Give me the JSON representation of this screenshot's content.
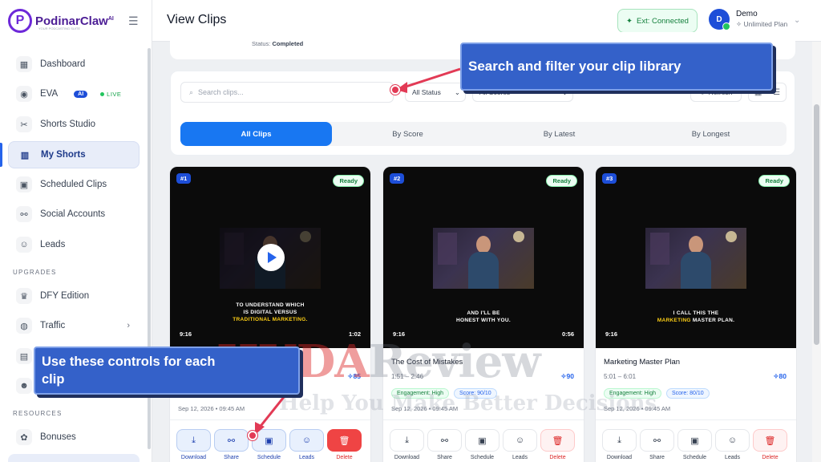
{
  "app": {
    "logo_letter": "P",
    "logo_name": "PodinarClaw",
    "logo_ai": "AI",
    "logo_tagline": "YOUR PODCASTING SUITE"
  },
  "sidebar": {
    "items": [
      {
        "label": "Dashboard",
        "icon": "▦"
      },
      {
        "label": "EVA",
        "icon": "◉",
        "badge": "AI",
        "live": "LIVE"
      },
      {
        "label": "Shorts Studio",
        "icon": "✂"
      },
      {
        "label": "My Shorts",
        "icon": "▥"
      },
      {
        "label": "Scheduled Clips",
        "icon": "▣"
      },
      {
        "label": "Social Accounts",
        "icon": "⚯"
      },
      {
        "label": "Leads",
        "icon": "☺"
      }
    ],
    "upgrades_label": "UPGRADES",
    "upgrade_items": [
      {
        "label": "DFY Edition",
        "icon": "♛"
      },
      {
        "label": "Traffic",
        "icon": "◍"
      }
    ],
    "resources_label": "RESOURCES",
    "resource_items": [
      {
        "label": "Bonuses",
        "icon": "✿"
      }
    ]
  },
  "header": {
    "title": "View Clips",
    "ext_status": "Ext: Connected",
    "user_initial": "D",
    "user_name": "Demo",
    "user_plan": "Unlimited Plan"
  },
  "status_card": {
    "label": "Status:",
    "value": "Completed"
  },
  "filters": {
    "search_placeholder": "Search clips...",
    "status_select": "All Status",
    "score_select": "All Scores",
    "refresh": "Refresh",
    "tabs": [
      "All Clips",
      "By Score",
      "By Latest",
      "By Longest"
    ]
  },
  "clips": [
    {
      "number": "#1",
      "status": "Ready",
      "ratio": "9:16",
      "duration": "1:02",
      "caption_1": "TO UNDERSTAND WHICH",
      "caption_2": "IS DIGITAL VERSUS",
      "caption_3": "TRADITIONAL MARKETING.",
      "date": "Sep 12, 2026 • 09:45 AM"
    },
    {
      "number": "#2",
      "status": "Ready",
      "ratio": "9:16",
      "duration": "0:56",
      "caption_1": "AND I'LL BE",
      "caption_2": "HONEST WITH YOU.",
      "title": "The Cost of Mistakes",
      "range": "1:51 – 2:46",
      "score": "90",
      "engagement": "Engagement: High",
      "score_tag": "Score: 90/10",
      "date": "Sep 12, 2026 • 09:45 AM"
    },
    {
      "number": "#3",
      "status": "Ready",
      "ratio": "9:16",
      "duration": "1:00",
      "caption_1": "I CALL THIS THE",
      "caption_hl": "MARKETING",
      "caption_2": " MASTER PLAN.",
      "title": "Marketing Master Plan",
      "range": "5:01 – 6:01",
      "score": "80",
      "engagement": "Engagement: High",
      "score_tag": "Score: 80/10",
      "date": "Sep 12, 2026 • 09:45 AM"
    }
  ],
  "card1_score": "85",
  "actions": {
    "download": "Download",
    "share": "Share",
    "schedule": "Schedule",
    "leads": "Leads",
    "delete": "Delete"
  },
  "annotations": {
    "search_tip": "Search and filter your clip library",
    "controls_tip_1": "Use these controls for each",
    "controls_tip_2": "clip"
  },
  "watermark": {
    "word_1": "HUDA",
    "word_2": "Review",
    "tagline": "Help You Make Better Decisions"
  },
  "colors": {
    "primary": "#1877f2",
    "brand": "#4c1d95",
    "success": "#15803d",
    "danger": "#ef4444",
    "callout": "#3461c9",
    "marker": "#e23a55"
  }
}
